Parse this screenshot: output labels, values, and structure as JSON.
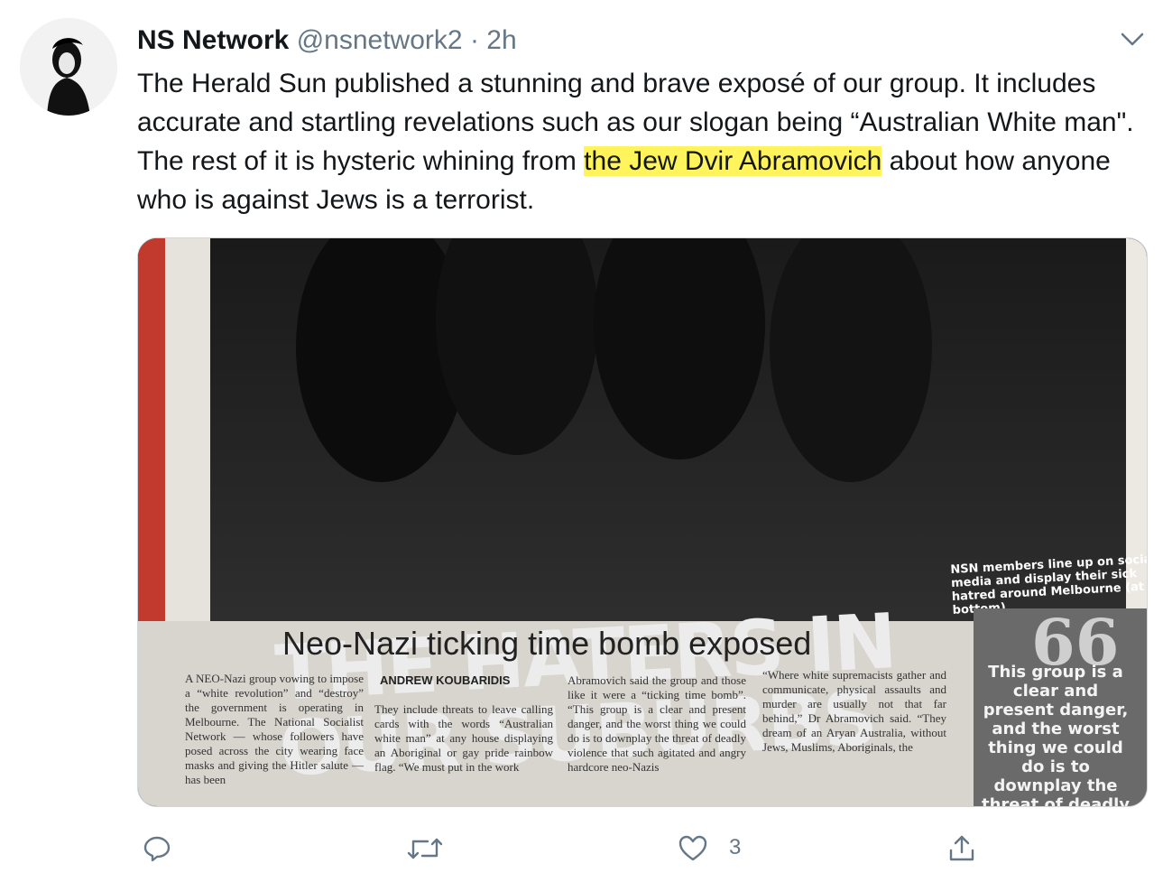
{
  "tweet": {
    "display_name": "NS Network",
    "handle": "@nsnetwork2",
    "separator": "·",
    "time": "2h",
    "text_part1": "The Herald Sun published a stunning and brave exposé of our group. It includes accurate and startling revelations such as our slogan being “Australian White man\". The rest of it is hysteric whining from",
    "text_highlight": "the Jew Dvir Abramovich",
    "text_part2": "about how anyone who is against Jews is a terrorist.",
    "highlight_color": "#fff45c"
  },
  "media": {
    "headline_line1": "THE HATERS IN",
    "headline_line2": "OUR SUBURBS",
    "caption": "NSN members line up on social media and display their sick hatred around Melbourne (at bottom).",
    "subheadline": "Neo-Nazi ticking time bomb exposed",
    "byline": "ANDREW KOUBARIDIS",
    "col1": "A NEO-Nazi group vowing to impose a “white revolution” and “destroy” the government is operating in Melbourne. The National Socialist Network — whose followers have posed across the city wearing face masks and giving the Hitler salute — has been",
    "col2": "They include threats to leave calling cards with the words “Australian white man” at any house displaying an Aboriginal or gay pride rainbow flag. “We must put in the work",
    "col3": "Abramovich said the group and those like it were a “ticking time bomb”. “This group is a clear and present danger, and the worst thing we could do is to downplay the threat of deadly violence that such agitated and angry hardcore neo-Nazis",
    "col4": "“Where white supremacists gather and communicate, physical assaults and murder are usually not that far behind,” Dr Abramovich said. “They dream of an Aryan Australia, without Jews, Muslims, Aboriginals, the",
    "pullquote_mark": "66",
    "pullquote": "This group is a clear and present danger, and the worst thing we could do is to downplay the threat of deadly"
  },
  "actions": {
    "like_count": "3",
    "icons": [
      "reply-icon",
      "retweet-icon",
      "like-icon",
      "share-icon"
    ]
  }
}
